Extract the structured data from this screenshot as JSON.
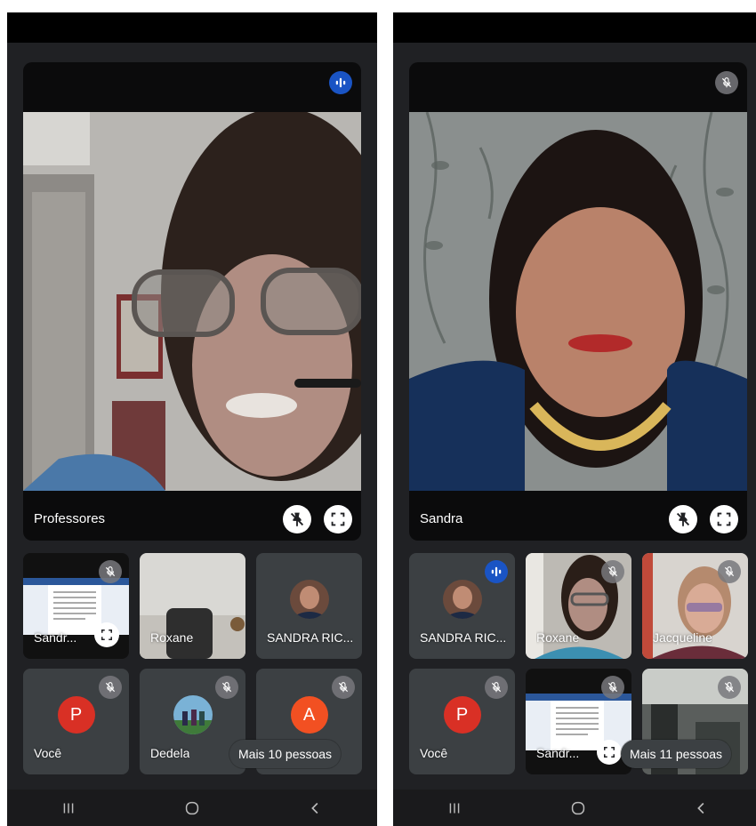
{
  "colors": {
    "background": "#202124",
    "tile": "#3c4043",
    "speaking_badge": "#1a54c4",
    "avatar_p": "#d93025",
    "avatar_a": "#f25022"
  },
  "left": {
    "main": {
      "name": "Professores",
      "status_icon": "speaking-icon",
      "buttons": [
        "unpin-icon",
        "fullscreen-icon"
      ]
    },
    "tiles": [
      {
        "name": "Sandr...",
        "type": "screen-share",
        "status_icon": "mic-off-icon"
      },
      {
        "name": "Roxane",
        "type": "video",
        "status_icon": ""
      },
      {
        "name": "SANDRA RIC...",
        "type": "avatar-photo",
        "status_icon": ""
      },
      {
        "name": "Você",
        "type": "avatar-letter",
        "letter": "P",
        "status_icon": "mic-off-icon"
      },
      {
        "name": "Dedela",
        "type": "avatar-photo",
        "status_icon": "mic-off-icon"
      },
      {
        "name": "",
        "type": "avatar-letter",
        "letter": "A",
        "status_icon": "mic-off-icon"
      }
    ],
    "more_label": "Mais 10 pessoas"
  },
  "right": {
    "main": {
      "name": "Sandra",
      "status_icon": "mic-off-icon",
      "buttons": [
        "unpin-icon",
        "fullscreen-icon"
      ]
    },
    "tiles": [
      {
        "name": "SANDRA RIC...",
        "type": "avatar-photo",
        "status_icon": "speaking-icon"
      },
      {
        "name": "Roxane",
        "type": "video",
        "status_icon": "mic-off-icon"
      },
      {
        "name": "Jacqueline",
        "type": "video",
        "status_icon": "mic-off-icon"
      },
      {
        "name": "Você",
        "type": "avatar-letter",
        "letter": "P",
        "status_icon": "mic-off-icon"
      },
      {
        "name": "Sandr...",
        "type": "screen-share",
        "status_icon": "mic-off-icon"
      },
      {
        "name": "",
        "type": "video",
        "status_icon": "mic-off-icon"
      }
    ],
    "more_label": "Mais 11 pessoas"
  },
  "navbar": {
    "buttons": [
      "recents-icon",
      "home-icon",
      "back-icon"
    ]
  }
}
